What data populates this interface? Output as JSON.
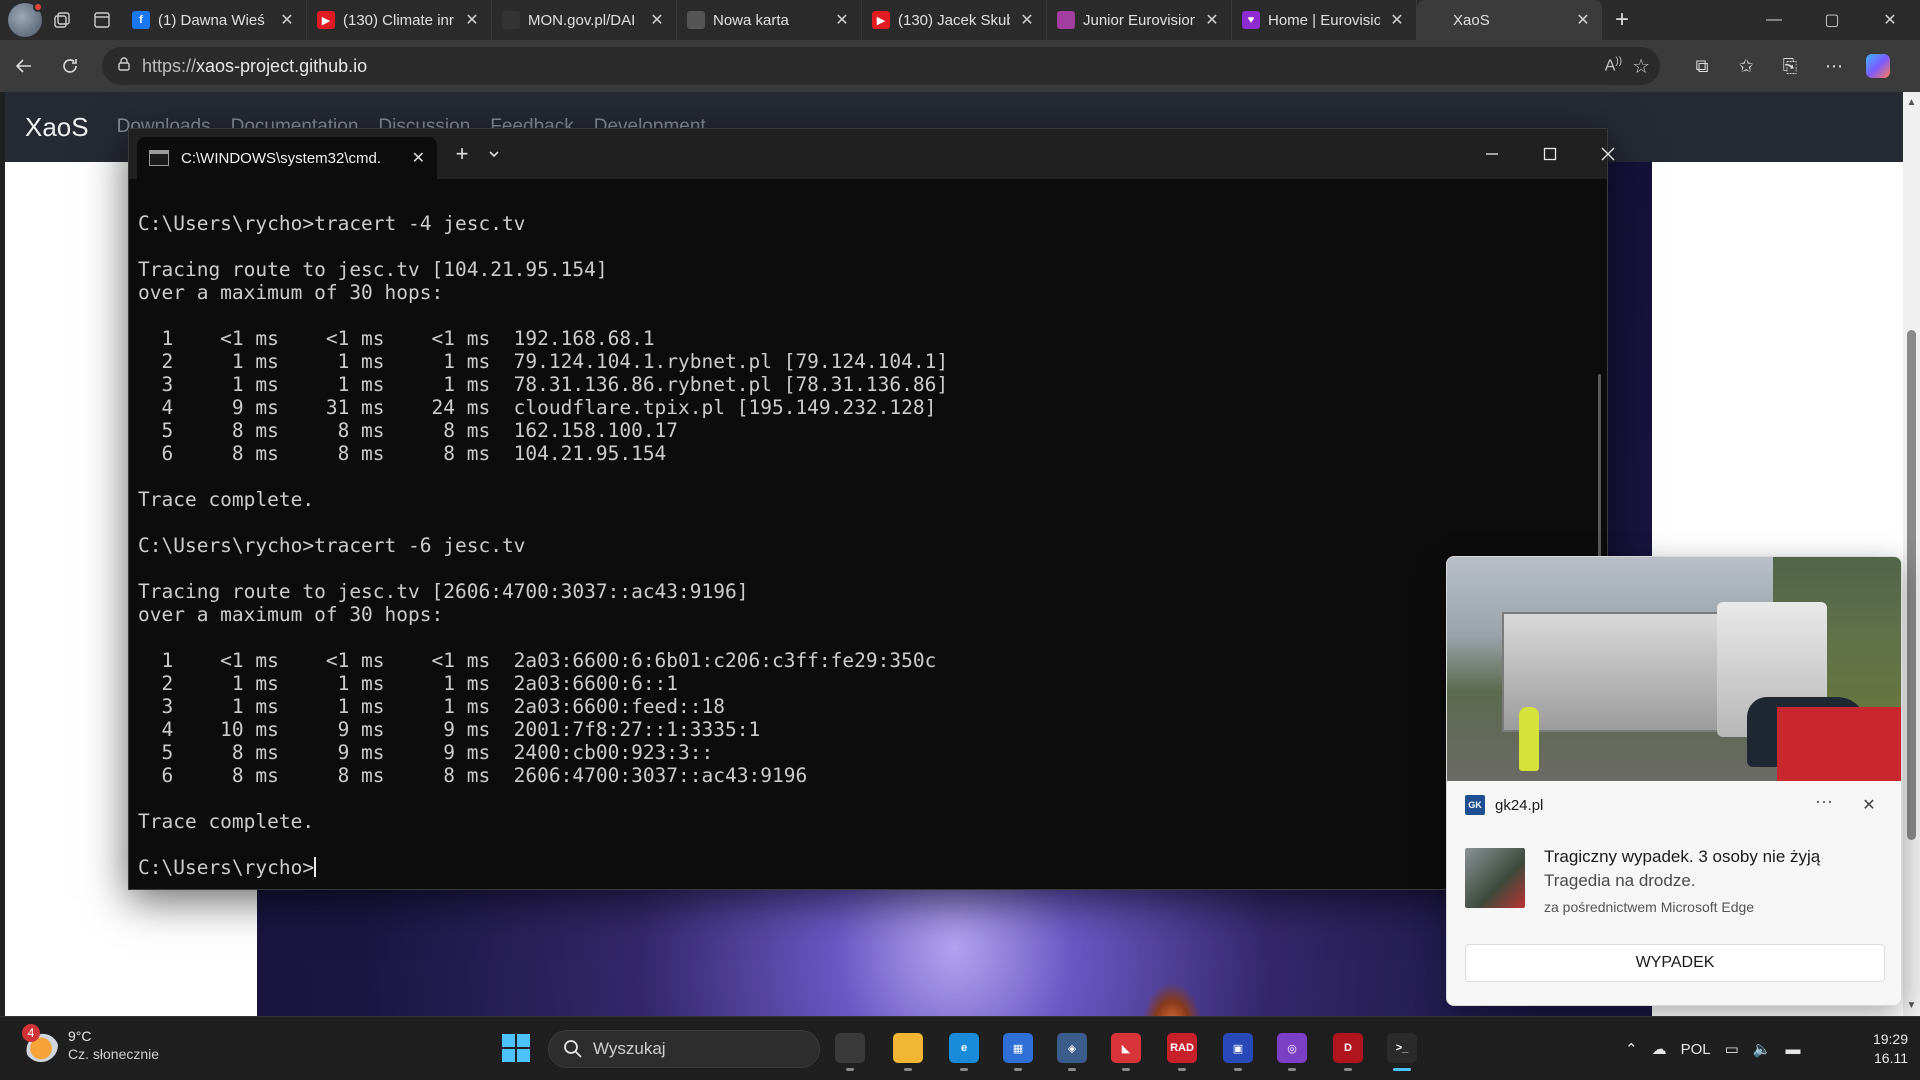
{
  "browser": {
    "tabs": [
      {
        "title": "(1) Dawna Wieś",
        "favicon": "facebook-icon",
        "color": "#1877f2",
        "glyph": "f"
      },
      {
        "title": "(130) Climate inr",
        "favicon": "youtube-icon",
        "color": "#e21b23",
        "glyph": "▶"
      },
      {
        "title": "MON.gov.pl/DAI",
        "favicon": "github-icon",
        "color": "#333333",
        "glyph": ""
      },
      {
        "title": "Nowa karta",
        "favicon": "new-tab-icon",
        "color": "#555555",
        "glyph": ""
      },
      {
        "title": "(130) Jacek Skub",
        "favicon": "youtube-icon",
        "color": "#e21b23",
        "glyph": "▶"
      },
      {
        "title": "Junior Eurovision",
        "favicon": "jesc-icon",
        "color": "#a23ea0",
        "glyph": ""
      },
      {
        "title": "Home | Eurovisio",
        "favicon": "eurovision-icon",
        "color": "#8b2bd1",
        "glyph": "♥"
      },
      {
        "title": "XaoS",
        "favicon": "globe-icon",
        "color": "#3b3b3b",
        "glyph": ""
      }
    ],
    "url_prefix": "https://",
    "url_host": "xaos-project.github.io"
  },
  "site": {
    "brand": "XaoS",
    "nav": [
      "Downloads",
      "Documentation",
      "Discussion",
      "Feedback",
      "Development"
    ]
  },
  "terminal": {
    "tab_title": "C:\\WINDOWS\\system32\\cmd.",
    "lines": [
      "",
      "C:\\Users\\rycho>tracert -4 jesc.tv",
      "",
      "Tracing route to jesc.tv [104.21.95.154]",
      "over a maximum of 30 hops:",
      "",
      "  1    <1 ms    <1 ms    <1 ms  192.168.68.1",
      "  2     1 ms     1 ms     1 ms  79.124.104.1.rybnet.pl [79.124.104.1]",
      "  3     1 ms     1 ms     1 ms  78.31.136.86.rybnet.pl [78.31.136.86]",
      "  4     9 ms    31 ms    24 ms  cloudflare.tpix.pl [195.149.232.128]",
      "  5     8 ms     8 ms     8 ms  162.158.100.17",
      "  6     8 ms     8 ms     8 ms  104.21.95.154",
      "",
      "Trace complete.",
      "",
      "C:\\Users\\rycho>tracert -6 jesc.tv",
      "",
      "Tracing route to jesc.tv [2606:4700:3037::ac43:9196]",
      "over a maximum of 30 hops:",
      "",
      "  1    <1 ms    <1 ms    <1 ms  2a03:6600:6:6b01:c206:c3ff:fe29:350c",
      "  2     1 ms     1 ms     1 ms  2a03:6600:6::1",
      "  3     1 ms     1 ms     1 ms  2a03:6600:feed::18",
      "  4    10 ms     9 ms     9 ms  2001:7f8:27::1:3335:1",
      "  5     8 ms     9 ms     9 ms  2400:cb00:923:3::",
      "  6     8 ms     8 ms     8 ms  2606:4700:3037::ac43:9196",
      "",
      "Trace complete.",
      ""
    ],
    "prompt": "C:\\Users\\rycho>"
  },
  "notification": {
    "source": "gk24.pl",
    "source_logo": "GK",
    "more": "···",
    "title": "Tragiczny wypadek. 3 osoby nie żyją",
    "subtitle": "Tragedia na drodze.",
    "via": "za pośrednictwem Microsoft Edge",
    "action": "WYPADEK"
  },
  "taskbar": {
    "weather_badge": "4",
    "temperature": "9°C",
    "condition": "Cz. słonecznie",
    "search_placeholder": "Wyszukaj",
    "language": "POL",
    "time": "19:29",
    "date": "16.11",
    "apps": [
      {
        "name": "task-view",
        "color": "#3a3a3a",
        "glyph": ""
      },
      {
        "name": "file-explorer",
        "color": "#f2b635",
        "glyph": ""
      },
      {
        "name": "edge",
        "color": "#1a8bd8",
        "glyph": "e"
      },
      {
        "name": "microsoft-store",
        "color": "#2f6fd6",
        "glyph": "▦"
      },
      {
        "name": "virtualbox",
        "color": "#3c5c8c",
        "glyph": "◈"
      },
      {
        "name": "flag-app",
        "color": "#d9343a",
        "glyph": "◣"
      },
      {
        "name": "rad-app",
        "color": "#c8202a",
        "glyph": "RAD"
      },
      {
        "name": "floppy-app",
        "color": "#2a49b8",
        "glyph": "▣"
      },
      {
        "name": "github-desktop",
        "color": "#7a3fc4",
        "glyph": "◎"
      },
      {
        "name": "d-app",
        "color": "#b0141c",
        "glyph": "D"
      },
      {
        "name": "terminal",
        "color": "#2b2b2b",
        "glyph": ">_"
      }
    ]
  }
}
